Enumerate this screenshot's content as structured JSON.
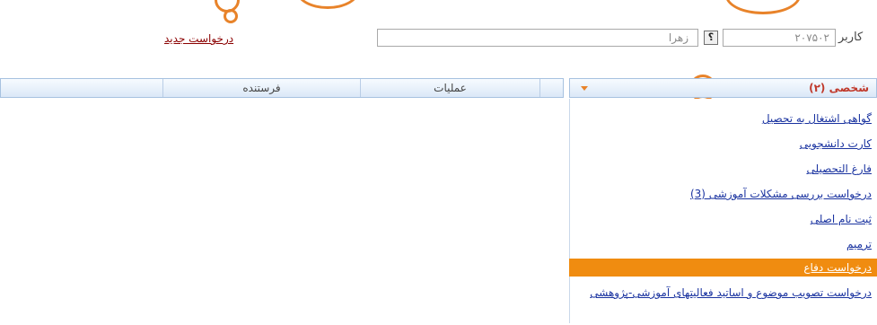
{
  "header": {
    "user_label": "کاربر",
    "user_code": "۲۰۷۵۰۲",
    "help_label": "؟",
    "user_name": "زهرا",
    "new_request_label": "درخواست جدید"
  },
  "grid": {
    "columns": [
      "عملیات",
      "فرستنده"
    ]
  },
  "panel": {
    "title": "شخصی (۲)",
    "items": [
      "گواهی اشتغال به تحصیل",
      "کارت دانشجویی",
      "فارغ التحصیلی",
      "درخواست بررسی مشکلات آموزشی (3)",
      "ثبت نام اصلی",
      "ترمیم",
      "درخواست دفاع",
      "درخواست تصویب موضوع و اساتید فعالیتهای آموزشی-پژوهشی"
    ],
    "active_index": 6
  },
  "colors": {
    "accent": "#f08c10",
    "annotation": "#e8832a",
    "link": "#1a33a0"
  }
}
